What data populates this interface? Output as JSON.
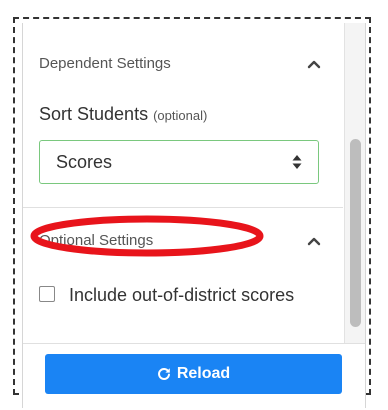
{
  "dependent_settings": {
    "title": "Dependent Settings",
    "collapse_icon": "chevron-up-icon",
    "sort_students": {
      "label": "Sort Students",
      "optional_note": "(optional)",
      "selected_value": "Scores",
      "select_icon": "sort-arrows-icon"
    }
  },
  "optional_settings": {
    "title": "Optional Settings",
    "collapse_icon": "chevron-up-icon",
    "include_out_of_district": {
      "label": "Include out-of-district scores",
      "checked": false
    }
  },
  "footer": {
    "reload_label": "Reload",
    "reload_icon": "refresh-icon",
    "reload_color": "#1a84f4"
  },
  "annotation": {
    "color": "#e8141b"
  }
}
